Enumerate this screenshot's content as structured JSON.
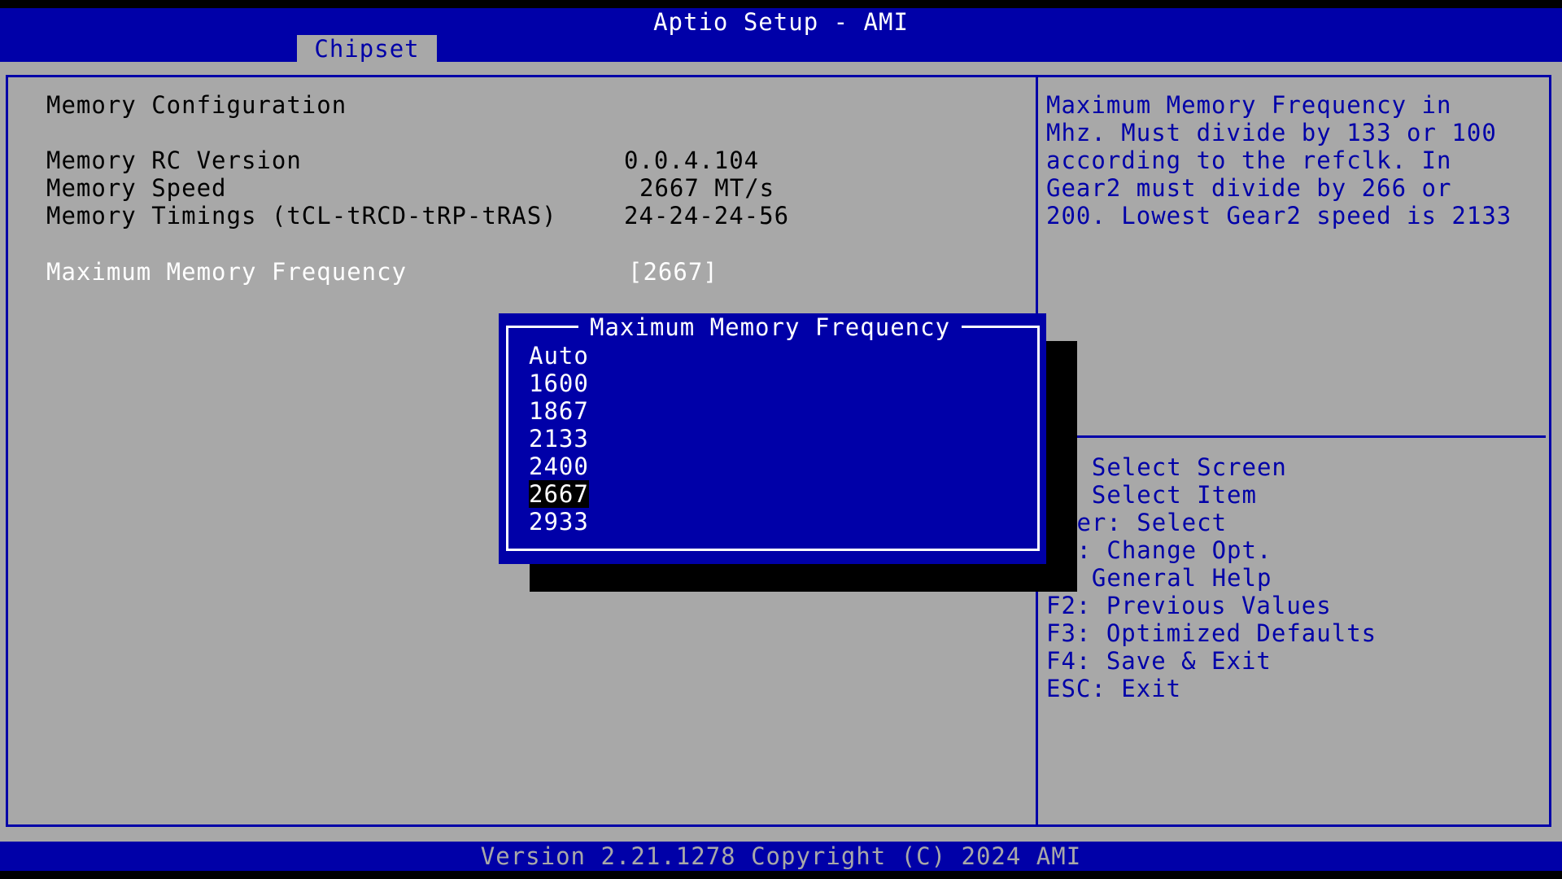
{
  "header": {
    "title": "Aptio Setup - AMI",
    "tabs": [
      {
        "label": "Chipset",
        "active": true
      }
    ]
  },
  "main": {
    "section_title": "Memory Configuration",
    "rows": [
      {
        "label": "Memory RC Version",
        "value": "0.0.4.104"
      },
      {
        "label": "Memory Speed",
        "value": "2667 MT/s"
      },
      {
        "label": "Memory Timings (tCL-tRCD-tRP-tRAS)",
        "value": "24-24-24-56"
      }
    ],
    "setting": {
      "label": "Maximum Memory Frequency",
      "value": "[2667]"
    }
  },
  "help": {
    "lines": [
      "Maximum Memory Frequency in",
      "Mhz. Must divide by 133 or 100",
      "according to the refclk. In",
      "Gear2 must divide by 266 or",
      "200. Lowest Gear2 speed is 2133"
    ]
  },
  "keys": {
    "lines": [
      ": Select Screen",
      ": Select Item",
      "ter: Select",
      "-: Change Opt.",
      ": General Help",
      "F2: Previous Values",
      "F3: Optimized Defaults",
      "F4: Save & Exit",
      "ESC: Exit"
    ]
  },
  "popup": {
    "title": "Maximum Memory Frequency",
    "options": [
      "Auto",
      "1600",
      "1867",
      "2133",
      "2400",
      "2667",
      "2933"
    ],
    "selected": "2667"
  },
  "footer": {
    "text": "Version 2.21.1278 Copyright (C) 2024 AMI"
  },
  "colors": {
    "bios_blue": "#0000a8",
    "bios_gray": "#a8a8a8",
    "text_white": "#ffffff",
    "text_black": "#000000"
  }
}
